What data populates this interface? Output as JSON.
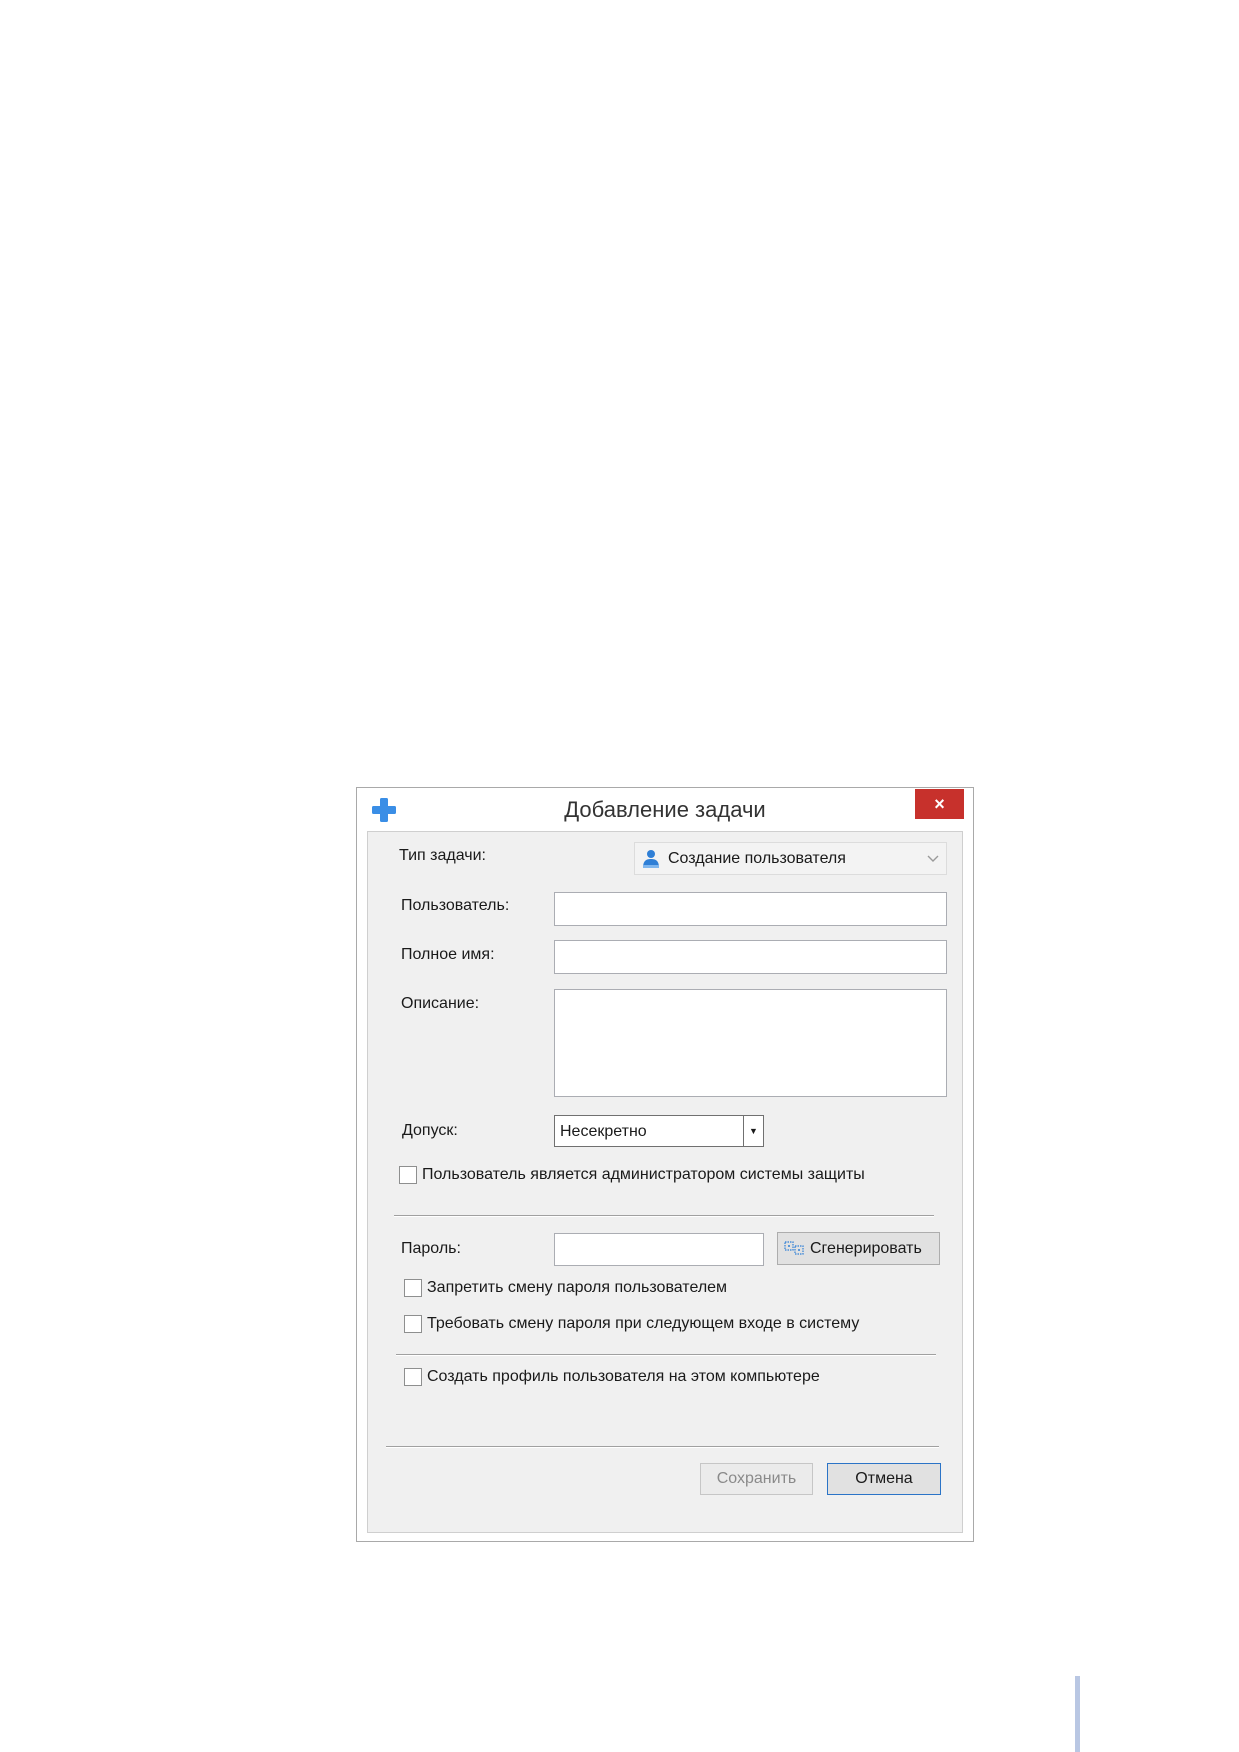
{
  "dialog": {
    "title": "Добавление задачи",
    "close_label": "×"
  },
  "form": {
    "task_type_label": "Тип задачи:",
    "task_type_value": "Создание пользователя",
    "user_label": "Пользователь:",
    "user_value": "",
    "fullname_label": "Полное имя:",
    "fullname_value": "",
    "description_label": "Описание:",
    "description_value": "",
    "clearance_label": "Допуск:",
    "clearance_value": "Несекретно",
    "admin_checkbox_label": "Пользователь является администратором системы защиты",
    "admin_checked": false,
    "password_label": "Пароль:",
    "password_value": "",
    "generate_label": "Сгенерировать",
    "forbid_change_label": "Запретить смену пароля пользователем",
    "forbid_change_checked": false,
    "require_change_label": "Требовать смену пароля при следующем входе в систему",
    "require_change_checked": false,
    "create_profile_label": "Создать профиль пользователя на этом компьютере",
    "create_profile_checked": false
  },
  "buttons": {
    "save_label": "Сохранить",
    "cancel_label": "Отмена"
  },
  "colors": {
    "close_button": "#c7312c",
    "accent": "#2b74c7",
    "client_bg": "#f0f0f0"
  },
  "icons": {
    "app": "plus-icon",
    "task_type": "user-icon",
    "generate": "dice-key-icon"
  }
}
